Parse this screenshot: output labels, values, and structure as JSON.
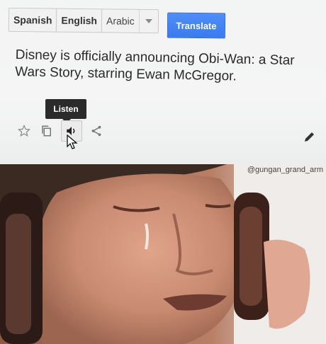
{
  "languages": {
    "tabs": [
      "Spanish",
      "English",
      "Arabic"
    ],
    "dropdown_icon": "chevron-down-icon"
  },
  "translate_button": {
    "label": "Translate"
  },
  "source_text": "Disney is officially announcing Obi-Wan: a Star Wars Story, starring Ewan McGregor.",
  "tooltip": {
    "label": "Listen"
  },
  "toolbar_icons": [
    "star-icon",
    "copy-icon",
    "speaker-icon",
    "share-icon"
  ],
  "edit_icon": "pencil-icon",
  "colors": {
    "translate_button": "#3a7af0",
    "tooltip_bg": "#2b2b2b",
    "text": "#2a2a2a"
  },
  "photo": {
    "watermark": "@gungan_grand_arm"
  }
}
